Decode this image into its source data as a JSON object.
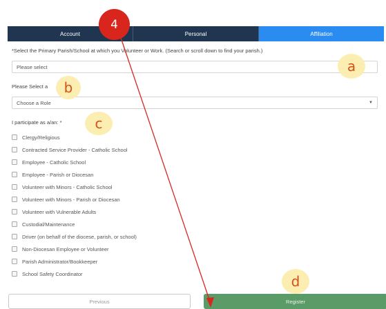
{
  "tabs": [
    {
      "label": "Account"
    },
    {
      "label": "Personal"
    },
    {
      "label": "Affiliation"
    }
  ],
  "parish": {
    "prompt": "*Select the Primary Parish/School at which you Volunteer or Work. (Search or scroll down to find your parish.)",
    "value": "Please select"
  },
  "role": {
    "prompt": "Please Select a",
    "value": "Choose a Role"
  },
  "participate": {
    "prompt": "I participate as a/an: *",
    "options": [
      "Clergy/Religious",
      "Contracted Service Provider - Catholic School",
      "Employee - Catholic School",
      "Employee - Parish or Diocesan",
      "Volunteer with Minors - Catholic School",
      "Volunteer with Minors - Parish or Diocesan",
      "Volunteer with Vulnerable Adults",
      "Custodial/Maintenance",
      "Driver (on behalf of the diocese, parish, or school)",
      "Non-Diocesan Employee or Volunteer",
      "Parish Administrator/Bookkeeper",
      "School Safety Coordinator"
    ]
  },
  "buttons": {
    "previous": "Previous",
    "register": "Register"
  },
  "annotations": {
    "marker": "4",
    "a": "a",
    "b": "b",
    "c": "c",
    "d": "d"
  },
  "colors": {
    "tab_dark": "#1f3550",
    "tab_active": "#2a8cf0",
    "register": "#5b9b68",
    "annotation_bg": "#fbeeb0",
    "annotation_text": "#d94f1a",
    "marker": "#d9261c"
  }
}
